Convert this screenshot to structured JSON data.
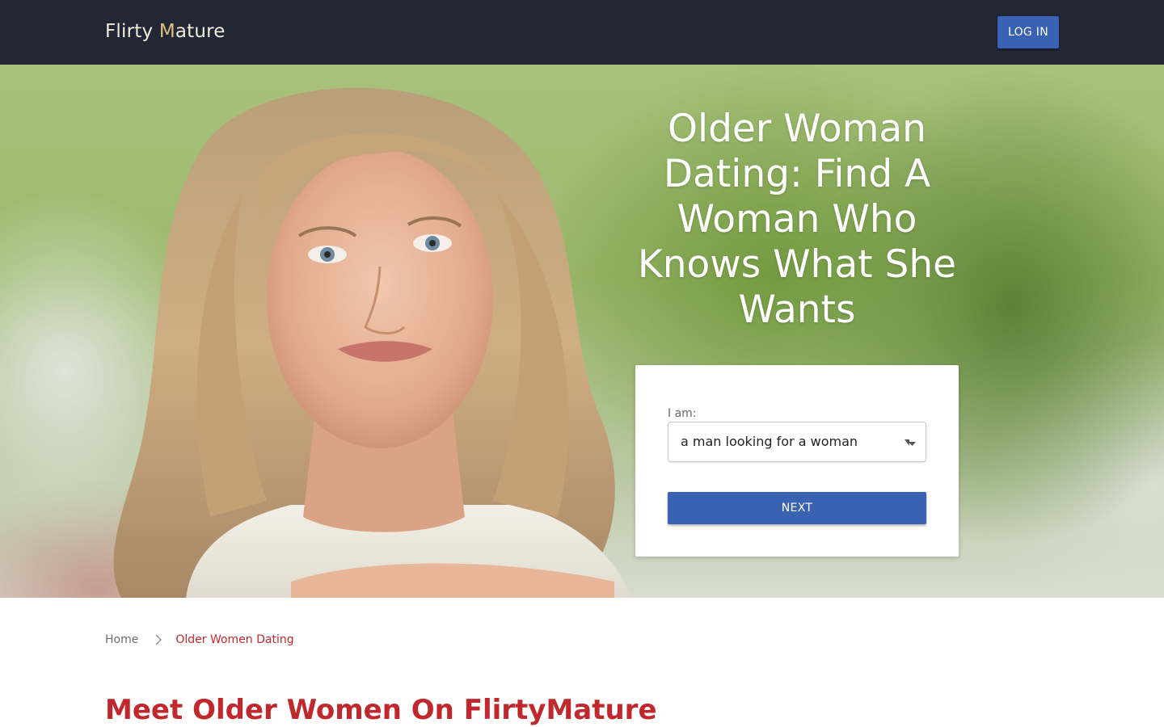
{
  "header": {
    "logo_part1": "Flirty ",
    "logo_part2": "M",
    "logo_part3": "ature",
    "login_label": "LOG IN"
  },
  "hero": {
    "title": "Older Woman Dating: Find A Woman Who Knows What She Wants"
  },
  "form": {
    "iam_label": "I am:",
    "iam_selected": "a man looking for a woman",
    "next_label": "NEXT"
  },
  "breadcrumb": {
    "home": "Home",
    "current": "Older Women Dating"
  },
  "main": {
    "heading": "Meet Older Women On FlirtyMature"
  },
  "colors": {
    "header_bg": "#222736",
    "button_blue": "#3a62b2",
    "accent_red": "#c0282d",
    "logo_gold": "#e3c07b"
  },
  "icons": {
    "select_caret": "caret-down-icon",
    "breadcrumb_separator": "chevron-right-icon"
  }
}
